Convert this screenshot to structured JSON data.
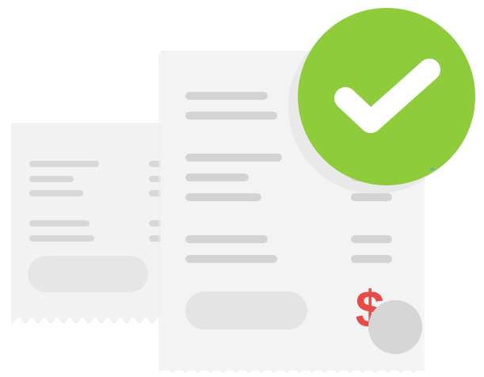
{
  "illustration": {
    "subject": "receipt-approved-illustration",
    "currency_symbol": "$",
    "icons": [
      "receipt-icon",
      "checkmark-badge-icon",
      "dollar-icon"
    ]
  },
  "colors": {
    "background": "#ffffff",
    "receipt_back": "#f2f2f2",
    "receipt_front": "#f3f3f3",
    "line_back": "#d8d8d8",
    "line_front": "#d3d3d3",
    "pill": "#e4e4e4",
    "check_badge": "#8ecc3c",
    "check_mark": "#ffffff",
    "dollar": "#e84a4a",
    "coin": "#d6d6d6",
    "shadow": "#dcdcdc"
  }
}
